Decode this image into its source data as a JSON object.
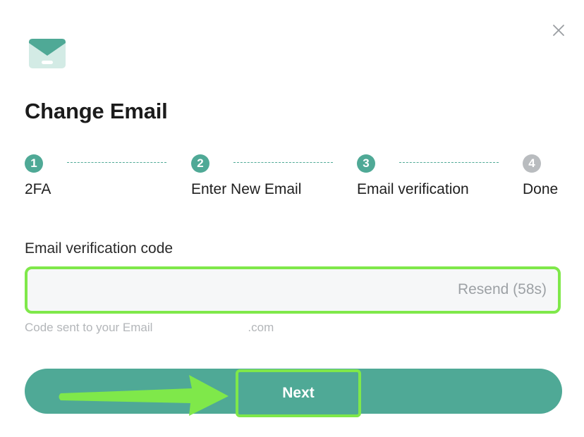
{
  "dialog": {
    "title": "Change Email",
    "close_icon": "close-icon",
    "header_icon": "mail-icon"
  },
  "stepper": {
    "steps": [
      {
        "number": "1",
        "label": "2FA",
        "state": "completed"
      },
      {
        "number": "2",
        "label": "Enter New Email",
        "state": "completed"
      },
      {
        "number": "3",
        "label": "Email verification",
        "state": "active"
      },
      {
        "number": "4",
        "label": "Done",
        "state": "pending"
      }
    ]
  },
  "verification": {
    "label": "Email verification code",
    "value": "",
    "placeholder": "",
    "resend_label": "Resend (58s)",
    "hint_prefix": "Code sent to your Email",
    "hint_suffix": ".com"
  },
  "actions": {
    "next_label": "Next"
  },
  "colors": {
    "accent": "#4fa996",
    "highlight": "#7fe84a",
    "inactive": "#b9bcbf"
  }
}
